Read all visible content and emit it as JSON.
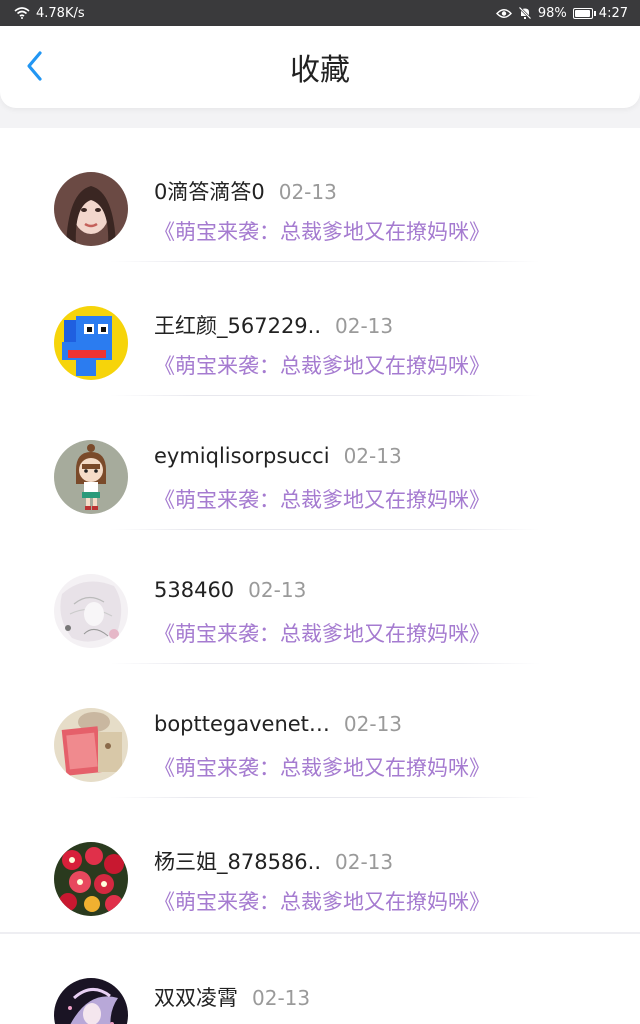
{
  "status_bar": {
    "speed": "4.78K/s",
    "battery": "98%",
    "battery_level": 0.98,
    "time": "4:27",
    "icons": [
      "wifi-icon",
      "eye-icon",
      "mute-bell-icon",
      "battery-icon"
    ]
  },
  "header": {
    "title": "收藏",
    "back_icon": "chevron-left-icon",
    "accent": "#2196f3"
  },
  "items": [
    {
      "name": "0滴答滴答0",
      "date": "02-13",
      "book": "《萌宝来袭：总裁爹地又在撩妈咪》"
    },
    {
      "name": "王红颜_567229..",
      "date": "02-13",
      "book": "《萌宝来袭：总裁爹地又在撩妈咪》"
    },
    {
      "name": "eymiqlisorpsucci",
      "date": "02-13",
      "book": "《萌宝来袭：总裁爹地又在撩妈咪》"
    },
    {
      "name": "538460",
      "date": "02-13",
      "book": "《萌宝来袭：总裁爹地又在撩妈咪》"
    },
    {
      "name": "bopttegavenet…",
      "date": "02-13",
      "book": "《萌宝来袭：总裁爹地又在撩妈咪》"
    },
    {
      "name": "杨三姐_878586..",
      "date": "02-13",
      "book": "《萌宝来袭：总裁爹地又在撩妈咪》"
    },
    {
      "name": "双双凌霄",
      "date": "02-13",
      "book": ""
    }
  ],
  "colors": {
    "book_link": "#a57bd0",
    "date": "#9a9a9a"
  }
}
